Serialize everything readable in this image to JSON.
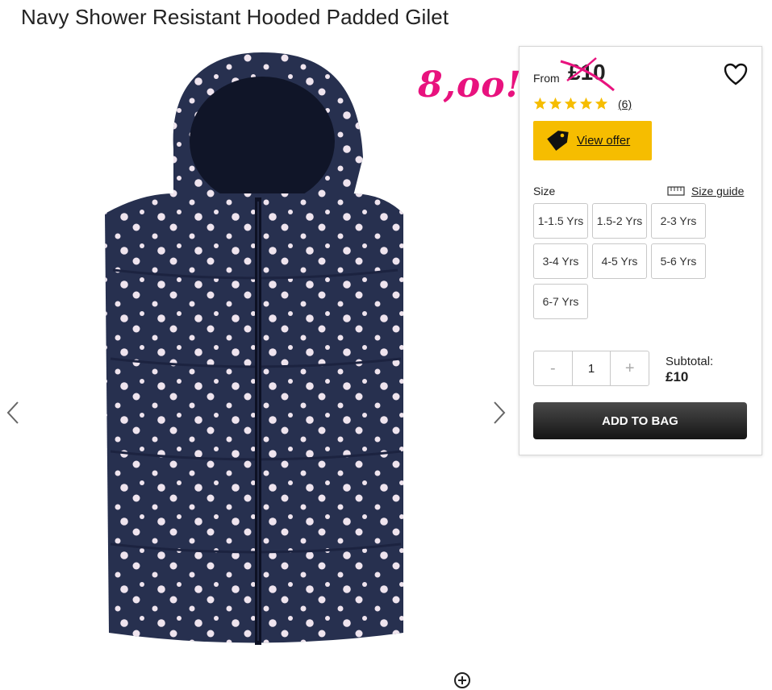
{
  "product": {
    "title": "Navy Shower Resistant Hooded Padded Gilet",
    "image_icon": "navy-polka-dot-gilet-image"
  },
  "annotation": {
    "text": "8,oo!",
    "color": "#e8127e"
  },
  "panel": {
    "from_label": "From",
    "price": "£10",
    "rating": {
      "stars": 5,
      "max": 5,
      "count_label": "(6)"
    },
    "offer_button": "View offer",
    "size_label": "Size",
    "size_guide": "Size guide",
    "sizes": [
      "1-1.5 Yrs",
      "1.5-2 Yrs",
      "2-3 Yrs",
      "3-4 Yrs",
      "4-5 Yrs",
      "5-6 Yrs",
      "6-7 Yrs"
    ],
    "quantity": {
      "minus": "-",
      "value": "1",
      "plus": "+"
    },
    "subtotal_label": "Subtotal:",
    "subtotal_value": "£10",
    "add_button": "ADD TO BAG"
  },
  "colors": {
    "accent": "#f6bd00",
    "star": "#f6bd00",
    "strike": "#e8127e",
    "gilet": "#27304f"
  }
}
